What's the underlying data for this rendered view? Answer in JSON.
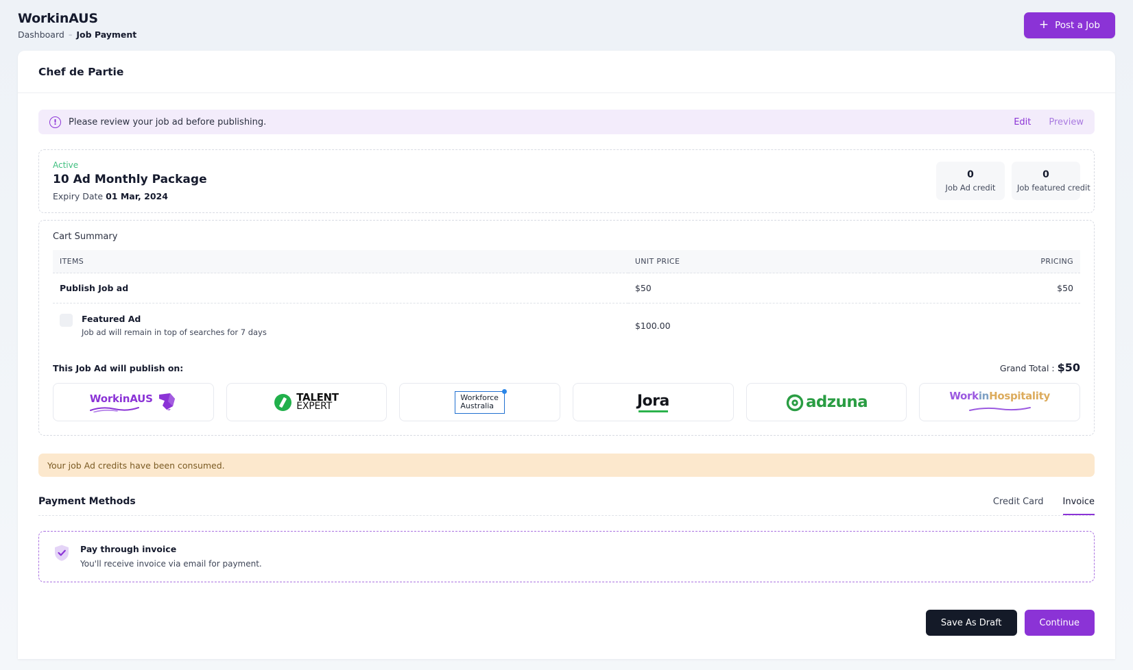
{
  "header": {
    "brand": "WorkinAUS",
    "breadcrumb": {
      "root": "Dashboard",
      "separator": "–",
      "current": "Job Payment"
    },
    "post_job_button": "Post a Job",
    "post_job_plus": "+"
  },
  "page": {
    "job_title": "Chef de Partie"
  },
  "review_banner": {
    "icon": "!",
    "message": "Please review your job ad before publishing.",
    "edit_label": "Edit",
    "preview_label": "Preview"
  },
  "package": {
    "status": "Active",
    "name": "10 Ad Monthly Package",
    "expiry_prefix": "Expiry Date",
    "expiry_date": "01 Mar, 2024",
    "credits": [
      {
        "value": "0",
        "label": "Job Ad credit"
      },
      {
        "value": "0",
        "label": "Job featured credit"
      }
    ]
  },
  "cart": {
    "title": "Cart Summary",
    "columns": [
      "ITEMS",
      "UNIT PRICE",
      "PRICING"
    ],
    "rows": [
      {
        "name": "Publish Job ad",
        "description": "",
        "unit_price": "$50",
        "pricing": "$50",
        "has_checkbox": false
      },
      {
        "name": "Featured Ad",
        "description": "Job ad will remain in top of searches for 7 days",
        "unit_price": "$100.00",
        "pricing": "",
        "has_checkbox": true
      }
    ],
    "publish_label": "This Job Ad will publish on:",
    "grand_total_label": "Grand Total :",
    "grand_total_value": "$50",
    "boards": [
      {
        "name": "WorkinAUS",
        "part_a": "Workin",
        "part_b": "AUS"
      },
      {
        "name": "Talent Expert",
        "line1": "TALENT",
        "line2": "EXPERT"
      },
      {
        "name": "Workforce Australia",
        "line1": "Workforce",
        "line2": "Australia"
      },
      {
        "name": "Jora",
        "text": "Jora"
      },
      {
        "name": "adzuna",
        "text": "adzuna"
      },
      {
        "name": "WorkinHospitality",
        "part_a": "Work",
        "part_b": "in",
        "part_c": "Hospitality"
      }
    ]
  },
  "warning": {
    "message": "Your job Ad credits have been consumed."
  },
  "payment": {
    "title": "Payment Methods",
    "tabs": [
      {
        "label": "Credit Card",
        "active": false
      },
      {
        "label": "Invoice",
        "active": true
      }
    ],
    "invoice_option": {
      "name": "Pay through invoice",
      "description": "You'll receive invoice via email for payment.",
      "icon": "shield-check-icon"
    }
  },
  "footer": {
    "save_draft_label": "Save As Draft",
    "continue_label": "Continue"
  },
  "colors": {
    "accent": "#8b33d6",
    "active_green": "#3fbf7f",
    "warning_bg": "#fce8cd",
    "dark_button": "#141a28"
  }
}
